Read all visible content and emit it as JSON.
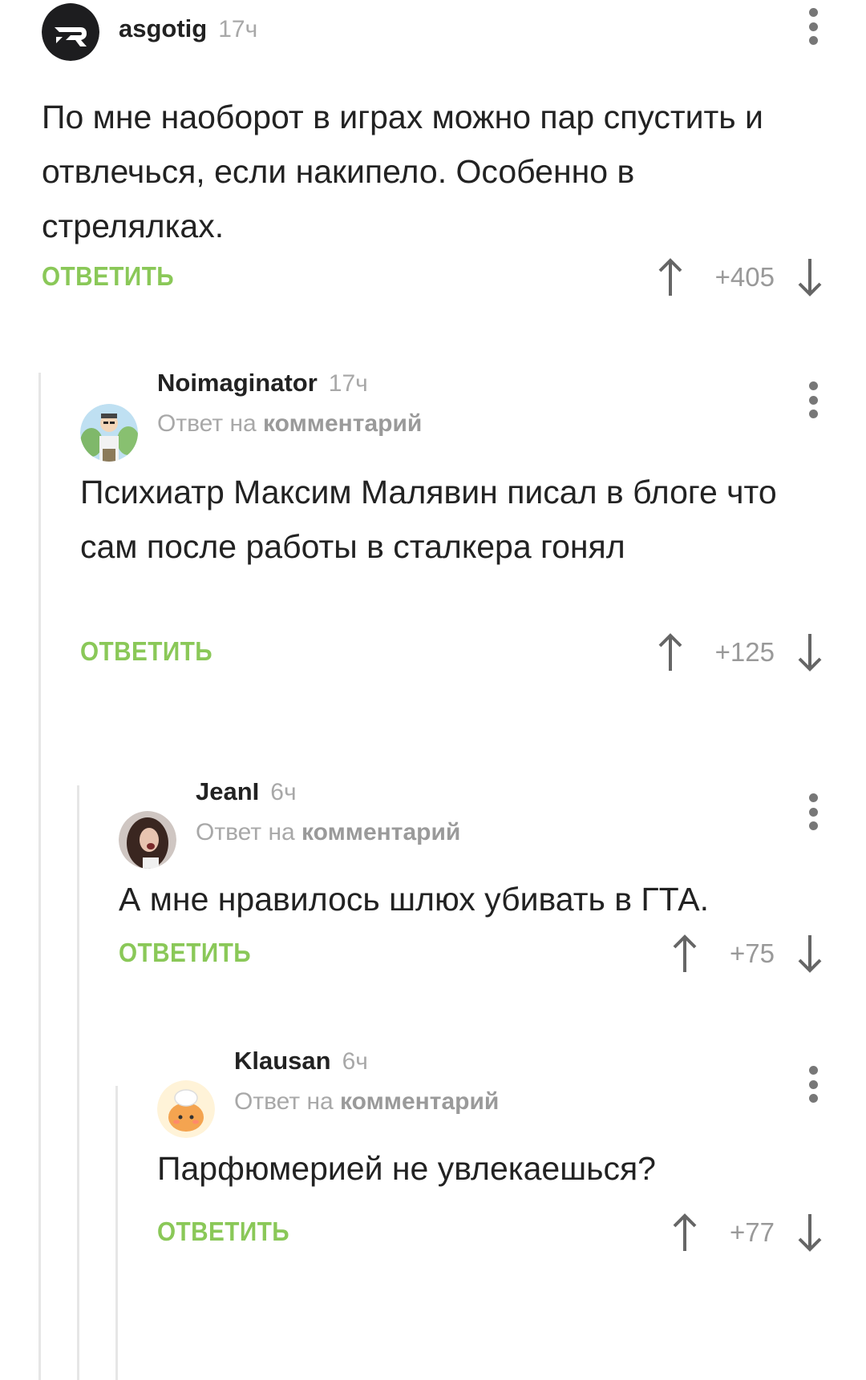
{
  "comments": [
    {
      "author": "asgotig",
      "time": "17ч",
      "reply_to": null,
      "text": "По мне наоборот в играх можно пар спустить и отвлечься, если накипело. Особенно в стрелялках.",
      "reply_label": "ОТВЕТИТЬ",
      "rating": "+405",
      "avatar": "logo-avatar"
    },
    {
      "author": "Noimaginator",
      "time": "17ч",
      "reply_to": {
        "prefix": "Ответ на",
        "target": "комментарий"
      },
      "text": "Психиатр Максим Малявин писал в блоге что сам после работы в сталкера гонял",
      "reply_label": "ОТВЕТИТЬ",
      "rating": "+125",
      "avatar": "cartoon-man-avatar"
    },
    {
      "author": "JeanI",
      "time": "6ч",
      "reply_to": {
        "prefix": "Ответ на",
        "target": "комментарий"
      },
      "text": "А мне нравилось шлюх убивать в ГТА.",
      "reply_label": "ОТВЕТИТЬ",
      "rating": "+75",
      "avatar": "photo-avatar"
    },
    {
      "author": "Klausan",
      "time": "6ч",
      "reply_to": {
        "prefix": "Ответ на",
        "target": "комментарий"
      },
      "text": "Парфюмерией не увлекаешься?",
      "reply_label": "ОТВЕТИТЬ",
      "rating": "+77",
      "avatar": "chef-avatar"
    }
  ],
  "colors": {
    "reply_button": "#8ac858",
    "meta_text": "#a8a8a8",
    "thread_line": "#e6e6e6"
  }
}
